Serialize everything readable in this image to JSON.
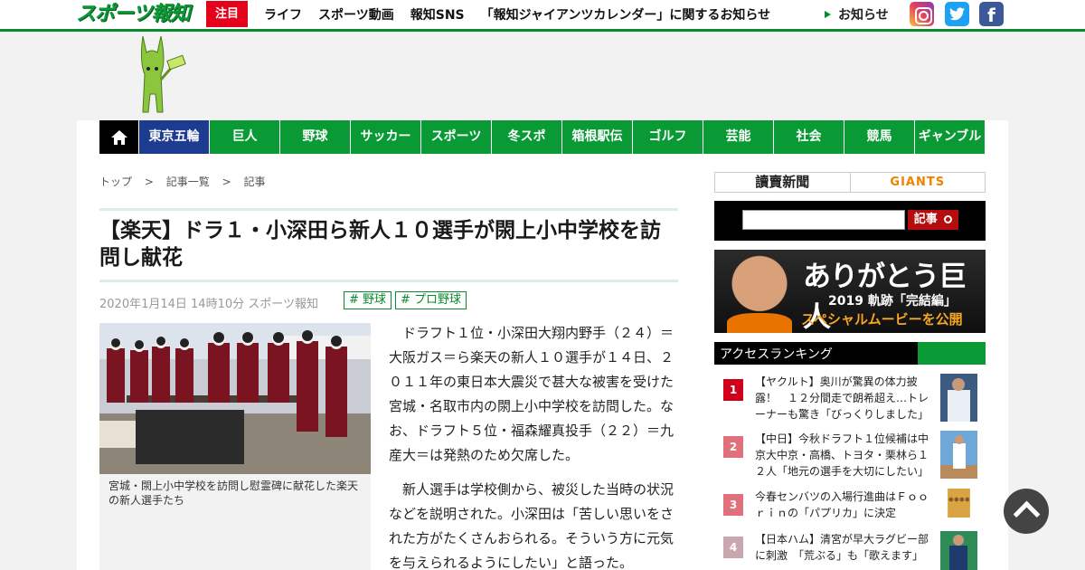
{
  "header": {
    "logo_text": "スポーツ報知",
    "chumoku_label": "注目",
    "nav": [
      "ライフ",
      "スポーツ動画",
      "報知SNS",
      "「報知ジャイアンツカレンダー」に関するお知らせ"
    ],
    "oshirase": "お知らせ",
    "sns": [
      "instagram-icon",
      "twitter-icon",
      "facebook-icon"
    ],
    "facebook_glyph": "f"
  },
  "category_nav": [
    "東京五輪",
    "巨人",
    "野球",
    "サッカー",
    "スポーツ",
    "冬スポ",
    "箱根駅伝",
    "ゴルフ",
    "芸能",
    "社会",
    "競馬",
    "ギャンブル"
  ],
  "breadcrumb": [
    "トップ",
    "記事一覧",
    "記事"
  ],
  "breadcrumb_sep": ">",
  "article": {
    "headline": "【楽天】ドラ１・小深田ら新人１０選手が閖上小中学校を訪問し献花",
    "meta": "2020年1月14日 14時10分  スポーツ報知",
    "tags": [
      "# 野球",
      "# プロ野球"
    ],
    "photo_caption": "宮城・閖上小中学校を訪問し慰霊碑に献花した楽天の新人選手たち",
    "paragraphs": [
      "ドラフト１位・小深田大翔内野手（２４）＝大阪ガス＝ら楽天の新人１０選手が１４日、２０１１年の東日本大震災で甚大な被害を受けた宮城・名取市内の閖上小中学校を訪問した。なお、ドラフト５位・福森耀真投手（２２）＝九産大＝は発熱のため欠席した。",
      "新人選手は学校側から、被災した当時の状況などを説明された。小深田は「苦しい思いをされた方がたくさんおられる。そういう方に元気を与えられるようにしたい」と語った。"
    ]
  },
  "sidebar": {
    "yomiuri": "讀賣新聞",
    "giants": "GIANTS",
    "search_button": "記事",
    "banner": {
      "line1": "ありがとう巨人",
      "line2": "2019 軌跡「完結編」",
      "line3": "スペシャルムービーを公開"
    },
    "ranking_title": "アクセスランキング",
    "ranking": [
      {
        "num": "1",
        "text": "【ヤクルト】奥川が驚異の体力披露！　１２分間走で朗希超え…トレーナーも驚き「びっくりしました」",
        "color": "#d0021b"
      },
      {
        "num": "2",
        "text": "【中日】今秋ドラフト１位候補は中京大中京・高橋、トヨタ・栗林ら１２人「地元の選手を大切にしたい」",
        "color": "#e0707c"
      },
      {
        "num": "3",
        "text": "今春センバツの入場行進曲はＦｏｏｒｉｎの「パプリカ」に決定",
        "color": "#e0707c"
      },
      {
        "num": "4",
        "text": "【日本ハム】清宮が早大ラグビー部に刺激　「荒ぶる」も「歌えます」",
        "color": "#c8a8ae"
      }
    ]
  },
  "colors": {
    "brand_green": "#0a9a35",
    "accent_red": "#e5001c",
    "olympic_blue": "#1d3b8f"
  }
}
